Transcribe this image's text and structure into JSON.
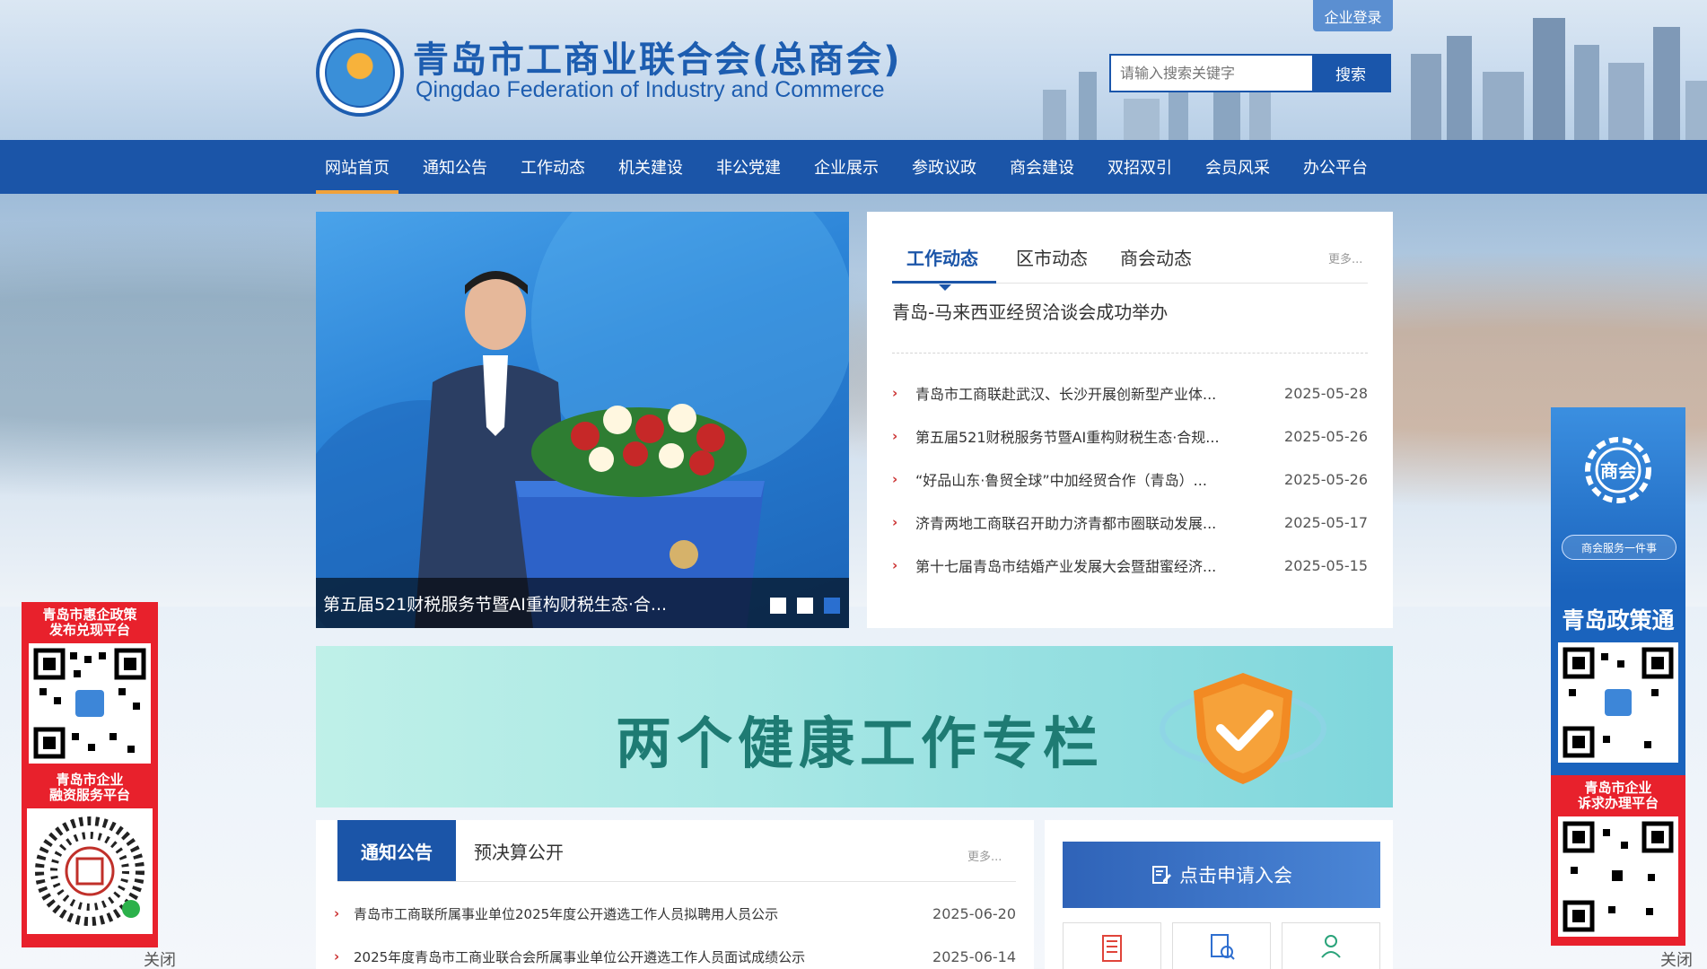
{
  "header": {
    "title": "青岛市工商业联合会(总商会)",
    "subtitle": "Qingdao Federation of Industry and Commerce",
    "login_label": "企业登录",
    "search_placeholder": "请输入搜索关键字",
    "search_label": "搜索"
  },
  "nav": {
    "items": [
      {
        "label": "网站首页"
      },
      {
        "label": "通知公告"
      },
      {
        "label": "工作动态"
      },
      {
        "label": "机关建设"
      },
      {
        "label": "非公党建"
      },
      {
        "label": "企业展示"
      },
      {
        "label": "参政议政"
      },
      {
        "label": "商会建设"
      },
      {
        "label": "双招双引"
      },
      {
        "label": "会员风采"
      },
      {
        "label": "办公平台"
      }
    ]
  },
  "slider": {
    "caption": "第五届521财税服务节暨AI重构财税生态·合..."
  },
  "news": {
    "tabs": [
      "工作动态",
      "区市动态",
      "商会动态"
    ],
    "more": "更多...",
    "headline": "青岛-马来西亚经贸洽谈会成功举办",
    "items": [
      {
        "title": "青岛市工商联赴武汉、长沙开展创新型产业体...",
        "date": "2025-05-28"
      },
      {
        "title": "第五届521财税服务节暨AI重构财税生态·合规...",
        "date": "2025-05-26"
      },
      {
        "title": "“好品山东·鲁贸全球”中加经贸合作（青岛）...",
        "date": "2025-05-26"
      },
      {
        "title": "济青两地工商联召开助力济青都市圈联动发展...",
        "date": "2025-05-17"
      },
      {
        "title": "第十七届青岛市结婚产业发展大会暨甜蜜经济...",
        "date": "2025-05-15"
      }
    ]
  },
  "banner": {
    "title": "两个健康工作专栏"
  },
  "notice": {
    "tab_active": "通知公告",
    "tab_other": "预决算公开",
    "more": "更多...",
    "items": [
      {
        "title": "青岛市工商联所属事业单位2025年度公开遴选工作人员拟聘用人员公示",
        "date": "2025-06-20"
      },
      {
        "title": "2025年度青岛市工商业联合会所属事业单位公开遴选工作人员面试成绩公示",
        "date": "2025-06-14"
      }
    ]
  },
  "apply": {
    "label": "点击申请入会"
  },
  "float_left": {
    "title1_line1": "青岛市惠企政策",
    "title1_line2": "发布兑现平台",
    "title2_line1": "青岛市企业",
    "title2_line2": "融资服务平台",
    "close": "关闭"
  },
  "float_right": {
    "top_label": "商会",
    "pill": "商会服务一件事",
    "mid_title": "青岛政策通",
    "bot_line1": "青岛市企业",
    "bot_line2": "诉求办理平台",
    "close": "关闭"
  },
  "colors": {
    "brand": "#1b55a8",
    "accent": "#f0a23a",
    "bullet": "#cc3333",
    "float_red": "#e8212c"
  }
}
